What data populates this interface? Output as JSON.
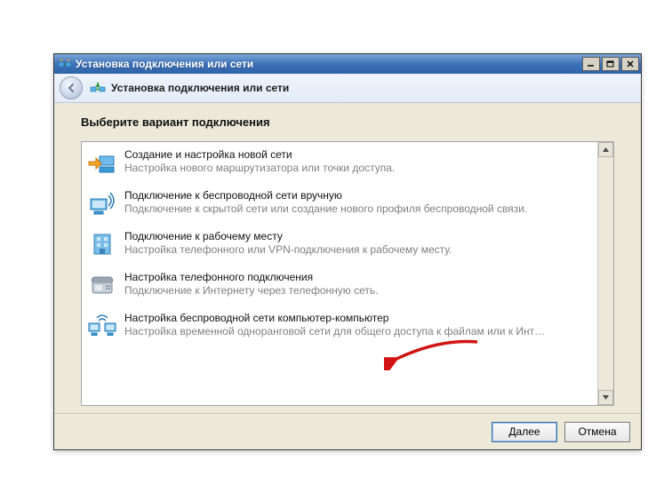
{
  "titlebar": {
    "title": "Установка подключения или сети"
  },
  "header": {
    "title": "Установка подключения или сети"
  },
  "instruction": "Выберите вариант подключения",
  "options": [
    {
      "title": "Создание и настройка новой сети",
      "desc": "Настройка нового маршрутизатора или точки доступа."
    },
    {
      "title": "Подключение к беспроводной сети вручную",
      "desc": "Подключение к скрытой сети или создание нового профиля беспроводной связи."
    },
    {
      "title": "Подключение к рабочему месту",
      "desc": "Настройка телефонного или VPN-подключения к рабочему месту."
    },
    {
      "title": "Настройка телефонного подключения",
      "desc": "Подключение к Интернету через телефонную сеть."
    },
    {
      "title": "Настройка беспроводной сети компьютер-компьютер",
      "desc": "Настройка временной одноранговой сети для общего доступа к файлам или к Инт…"
    }
  ],
  "footer": {
    "next": "Далее",
    "cancel": "Отмена"
  }
}
